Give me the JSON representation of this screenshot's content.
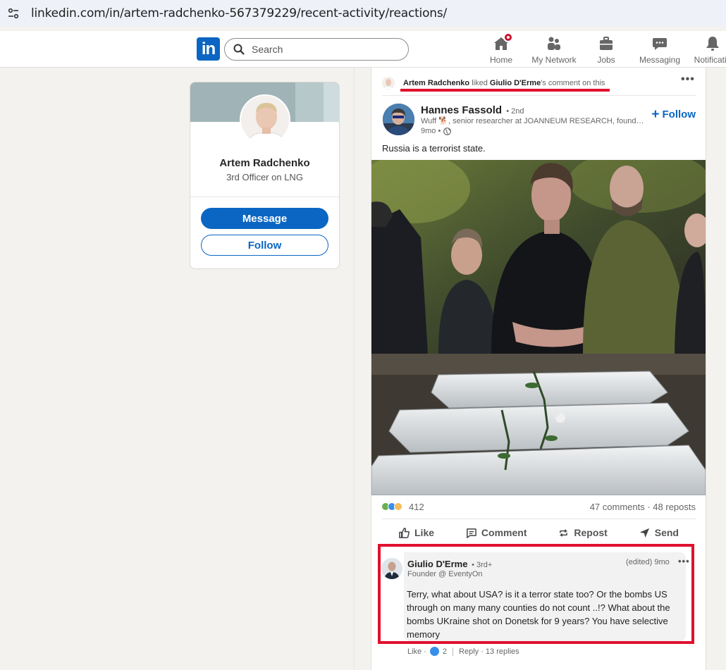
{
  "browser": {
    "url": "linkedin.com/in/artem-radchenko-567379229/recent-activity/reactions/"
  },
  "nav": {
    "logo": "in",
    "search_placeholder": "Search",
    "items": [
      {
        "label": "Home",
        "icon": "home-icon"
      },
      {
        "label": "My Network",
        "icon": "network-icon"
      },
      {
        "label": "Jobs",
        "icon": "briefcase-icon"
      },
      {
        "label": "Messaging",
        "icon": "message-icon"
      },
      {
        "label": "Notificatio",
        "icon": "bell-icon"
      }
    ]
  },
  "profile": {
    "name": "Artem Radchenko",
    "headline": "3rd Officer on LNG",
    "message_label": "Message",
    "follow_label": "Follow"
  },
  "activity": {
    "actor": "Artem Radchenko",
    "verb": " liked ",
    "target": "Giulio D'Erme",
    "suffix": "'s comment on this"
  },
  "post": {
    "author": "Hannes Fassold",
    "degree": "• 2nd",
    "description": "Wuff 🐕, senior researcher at JOANNEUM RESEARCH, founder of the AI & ML group",
    "time": "9mo •",
    "follow_label": "Follow",
    "text": "Russia is a terrorist state.",
    "reactions_count": "412",
    "comments_reposts": "47 comments · 48 reposts",
    "actions": [
      "Like",
      "Comment",
      "Repost",
      "Send"
    ]
  },
  "comment": {
    "author": "Giulio D'Erme",
    "degree": "• 3rd+",
    "headline": "Founder @ EventyOn",
    "meta": "(edited) 9mo",
    "text": "Terry, what about USA? is it a terror state too? Or the bombs US through on many many counties do not count ..!? What about the bombs UKraine shot on Donetsk for 9 years? You have selective memory",
    "like_label": "Like ·",
    "like_count": "2",
    "reply_label": "Reply · 13 replies"
  },
  "colors": {
    "brand": "#0a66c2",
    "highlight": "#e0112d"
  }
}
